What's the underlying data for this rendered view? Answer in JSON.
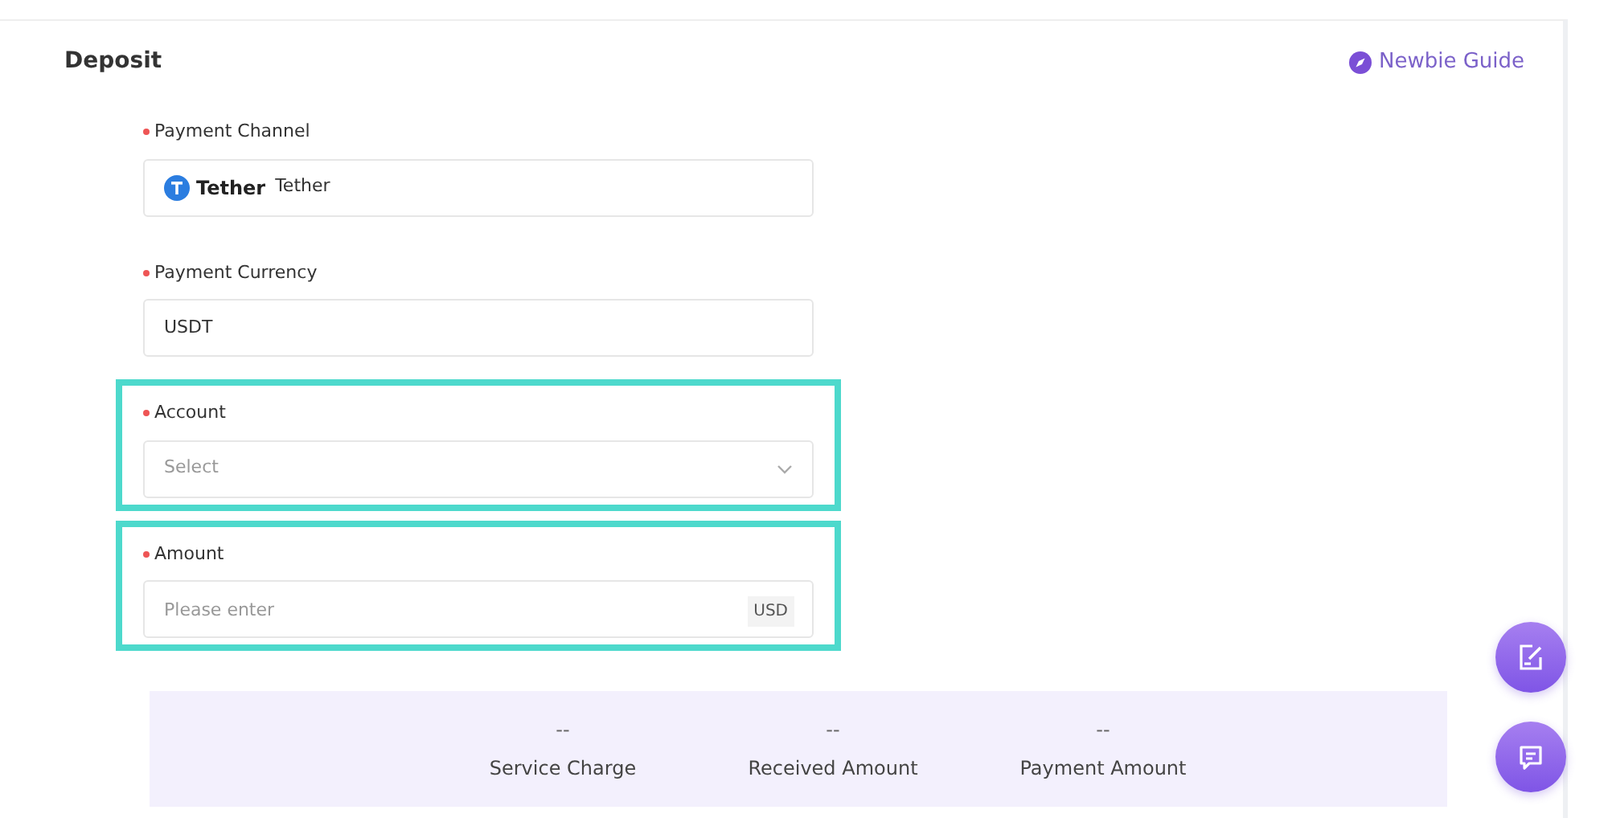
{
  "page": {
    "title": "Deposit",
    "guide_link": "Newbie Guide"
  },
  "fields": [
    {
      "kind": "channel",
      "label": "Payment Channel",
      "required": true,
      "highlighted": false,
      "logo_text": "Tether",
      "value": "Tether"
    },
    {
      "kind": "text",
      "label": "Payment Currency",
      "required": true,
      "highlighted": false,
      "value": "USDT"
    },
    {
      "kind": "select",
      "label": "Account",
      "required": true,
      "highlighted": true,
      "placeholder": "Select"
    },
    {
      "kind": "amount",
      "label": "Amount",
      "required": true,
      "highlighted": true,
      "placeholder": "Please enter",
      "unit": "USD"
    }
  ],
  "summary": [
    {
      "value": "--",
      "label": "Service Charge"
    },
    {
      "value": "--",
      "label": "Received Amount"
    },
    {
      "value": "--",
      "label": "Payment Amount"
    }
  ],
  "floating_buttons": [
    {
      "kind": "edit"
    },
    {
      "kind": "chat"
    }
  ]
}
